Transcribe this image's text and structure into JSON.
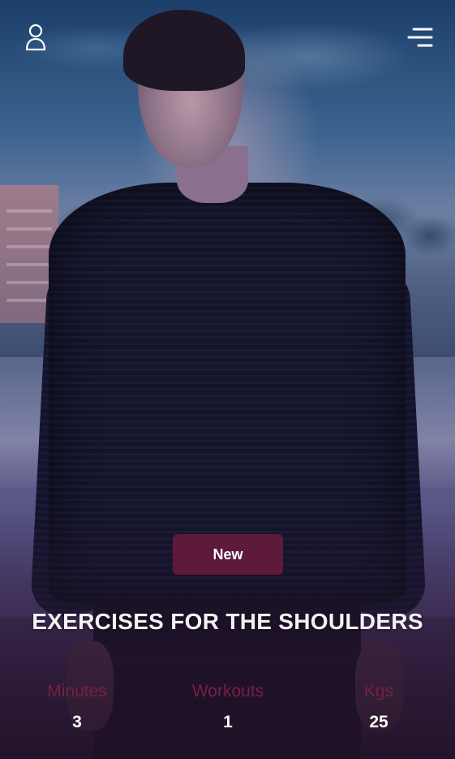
{
  "header": {
    "profile_icon": "user-outline-icon",
    "menu_icon": "hamburger-menu-icon"
  },
  "badge": {
    "label": "New",
    "color": "#5e1a3a"
  },
  "workout": {
    "title": "EXERCISES FOR THE SHOULDERS"
  },
  "stats": [
    {
      "label": "Minutes",
      "value": "3"
    },
    {
      "label": "Workouts",
      "value": "1"
    },
    {
      "label": "Kgs",
      "value": "25"
    }
  ],
  "colors": {
    "stat_label": "#7a1f44",
    "text": "#ffffff"
  }
}
